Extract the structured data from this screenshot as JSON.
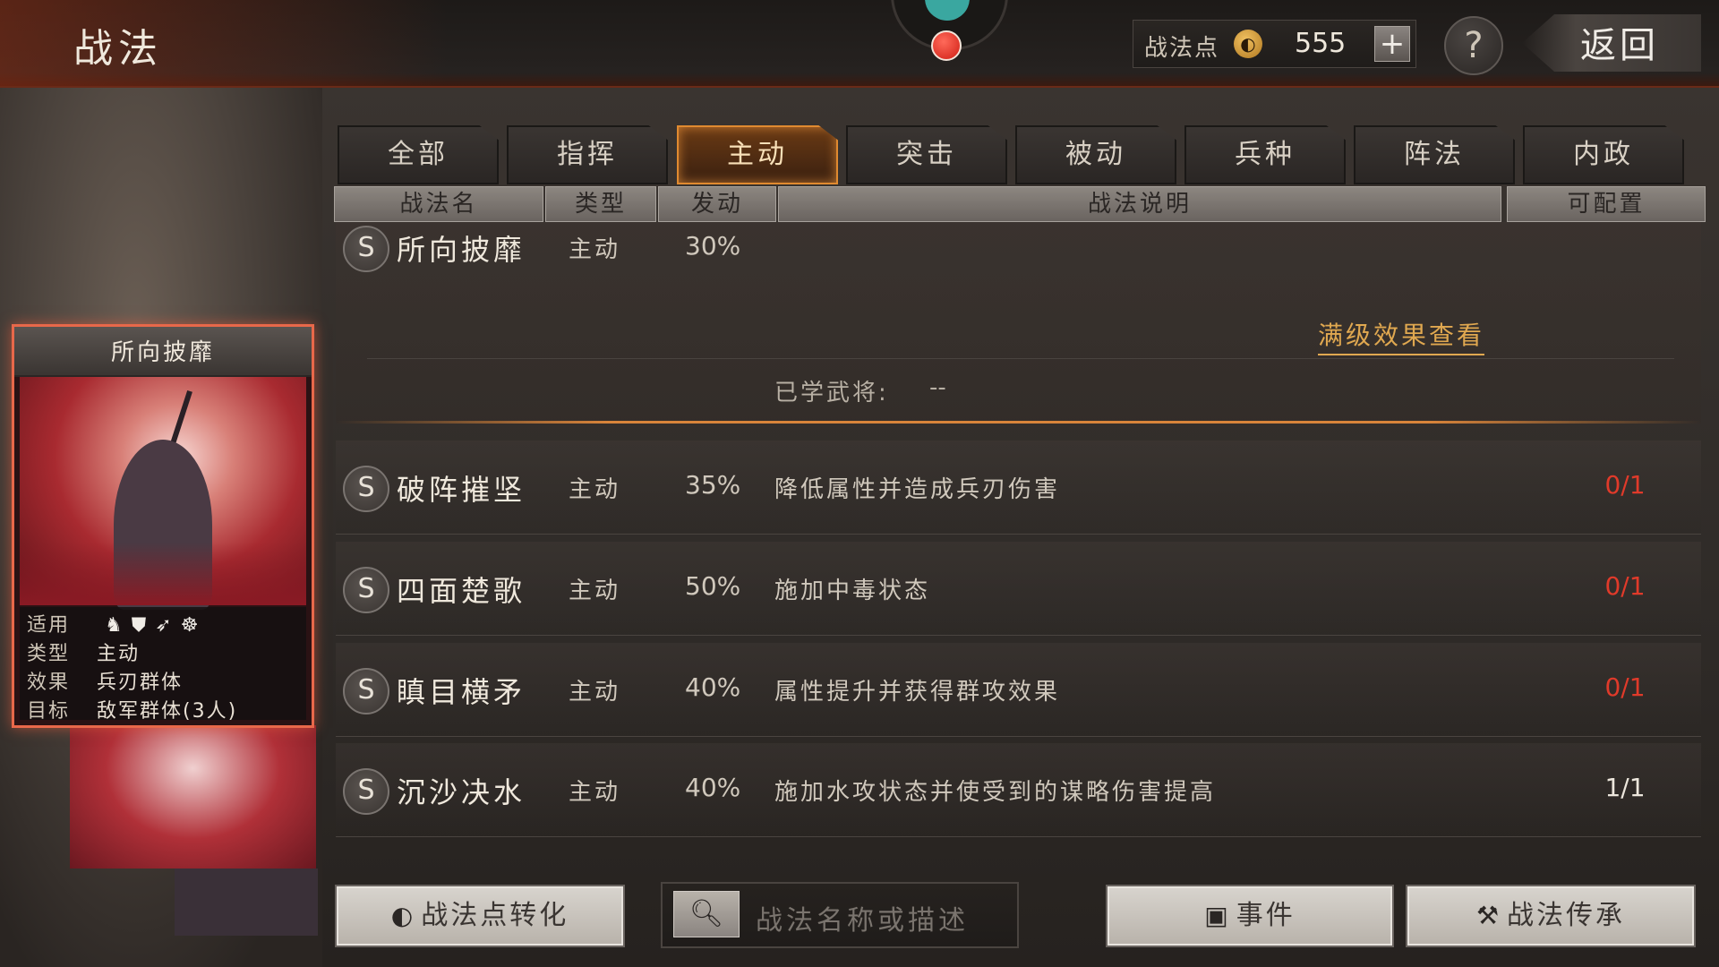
{
  "header": {
    "title": "战法",
    "points_label": "战法点",
    "points_icon": "flame-coin-icon",
    "points_value": "555",
    "plus_label": "+",
    "help_label": "?",
    "back_label": "返回"
  },
  "tabs": [
    {
      "label": "全部",
      "active": false
    },
    {
      "label": "指挥",
      "active": false
    },
    {
      "label": "主动",
      "active": true
    },
    {
      "label": "突击",
      "active": false
    },
    {
      "label": "被动",
      "active": false
    },
    {
      "label": "兵种",
      "active": false
    },
    {
      "label": "阵法",
      "active": false
    },
    {
      "label": "内政",
      "active": false
    }
  ],
  "table": {
    "headers": [
      "战法名",
      "类型",
      "发动",
      "战法说明",
      "可配置"
    ],
    "expanded": {
      "grade": "S",
      "name": "所向披靡",
      "type": "主动",
      "rate": "30%",
      "max_level_link": "满级效果查看",
      "learned_label": "已学武将:",
      "learned_value": "--"
    },
    "rows": [
      {
        "grade": "S",
        "name": "破阵摧坚",
        "type": "主动",
        "rate": "35%",
        "desc": "降低属性并造成兵刃伤害",
        "config": "0/1",
        "config_color": "#e03a2a"
      },
      {
        "grade": "S",
        "name": "四面楚歌",
        "type": "主动",
        "rate": "50%",
        "desc": "施加中毒状态",
        "config": "0/1",
        "config_color": "#e03a2a"
      },
      {
        "grade": "S",
        "name": "瞋目横矛",
        "type": "主动",
        "rate": "40%",
        "desc": "属性提升并获得群攻效果",
        "config": "0/1",
        "config_color": "#e03a2a"
      },
      {
        "grade": "S",
        "name": "沉沙决水",
        "type": "主动",
        "rate": "40%",
        "desc": "施加水攻状态并使受到的谋略伤害提高",
        "config": "1/1",
        "config_color": "#ece6dc"
      }
    ]
  },
  "card": {
    "title": "所向披靡",
    "info": {
      "applicable_label": "适用",
      "applicable_icons": [
        "cavalry-icon",
        "shield-icon",
        "archer-icon",
        "wheel-icon"
      ],
      "type_label": "类型",
      "type_value": "主动",
      "effect_label": "效果",
      "effect_value": "兵刃群体",
      "target_label": "目标",
      "target_value": "敌军群体(3人)"
    }
  },
  "bottom": {
    "convert_button": "战法点转化",
    "search_placeholder": "战法名称或描述",
    "event_button": "事件",
    "inherit_button": "战法传承"
  },
  "colors": {
    "accent_orange": "#e08a30",
    "config_red": "#e03a2a",
    "link_gold": "#e0a850"
  }
}
